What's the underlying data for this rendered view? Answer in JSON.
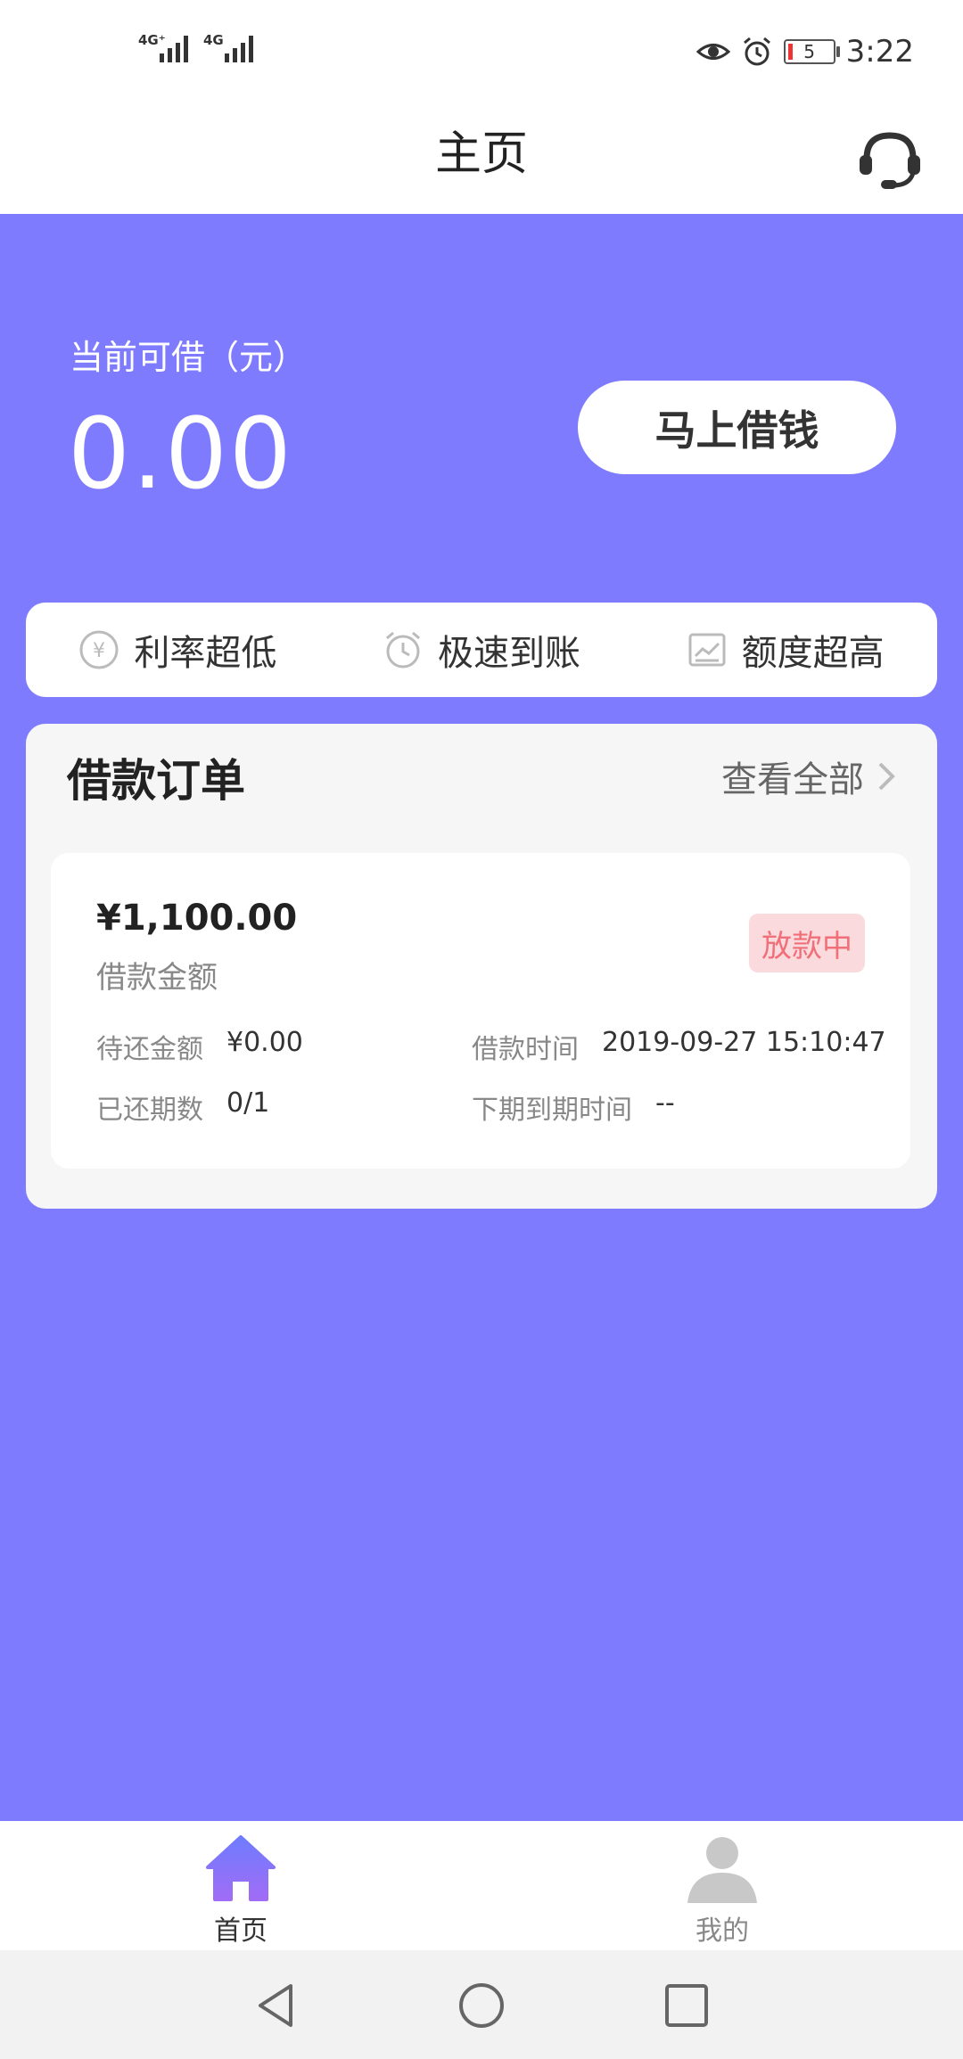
{
  "status_bar": {
    "sim1_tag": "4G⁺",
    "sim2_tag": "4G",
    "battery_level": "5",
    "time": "3:22"
  },
  "header": {
    "title": "主页"
  },
  "credit": {
    "label": "当前可借（元）",
    "amount": "0.00",
    "borrow_button": "马上借钱"
  },
  "features": [
    {
      "icon": "yen-circle-icon",
      "label": "利率超低"
    },
    {
      "icon": "clock-icon",
      "label": "极速到账"
    },
    {
      "icon": "trend-chart-icon",
      "label": "额度超高"
    }
  ],
  "orders": {
    "title": "借款订单",
    "view_all": "查看全部",
    "order": {
      "amount": "¥1,100.00",
      "amount_label": "借款金额",
      "status": "放款中",
      "pending_label": "待还金额",
      "pending_value": "¥0.00",
      "loan_time_label": "借款时间",
      "loan_time_value": "2019-09-27 15:10:47",
      "periods_label": "已还期数",
      "periods_value": "0/1",
      "next_due_label": "下期到期时间",
      "next_due_value": "--"
    }
  },
  "tabbar": {
    "home": "首页",
    "mine": "我的"
  },
  "colors": {
    "accent": "#7e7bff",
    "status_badge_bg": "#fadadd",
    "status_badge_text": "#f06f79"
  }
}
